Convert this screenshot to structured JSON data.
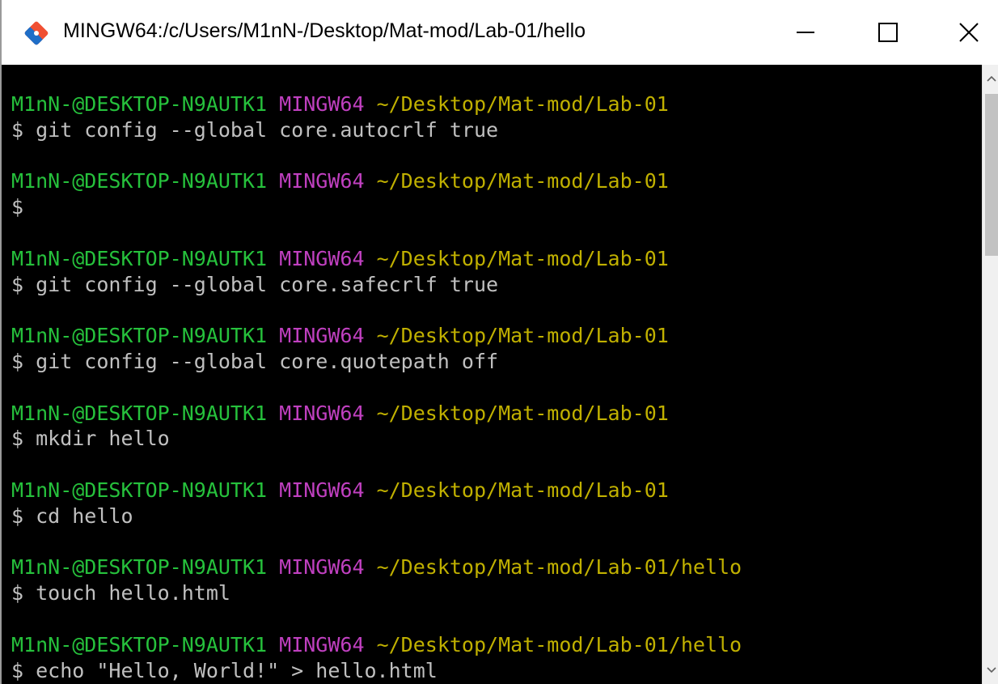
{
  "window": {
    "title": "MINGW64:/c/Users/M1nN-/Desktop/Mat-mod/Lab-01/hello",
    "icon": "git-bash-icon",
    "controls": [
      "minimize-icon",
      "maximize-icon",
      "close-icon"
    ]
  },
  "colors": {
    "user": "#26c13c",
    "msystem": "#c040c0",
    "path": "#c0b000",
    "command": "#c0c0c0",
    "background": "#000000"
  },
  "terminal": {
    "blocks": [
      {
        "user": "M1nN-@DESKTOP-N9AUTK1",
        "msystem": "MINGW64",
        "path": "~/Desktop/Mat-mod/Lab-01",
        "command": "$ git config --global core.autocrlf true"
      },
      {
        "user": "M1nN-@DESKTOP-N9AUTK1",
        "msystem": "MINGW64",
        "path": "~/Desktop/Mat-mod/Lab-01",
        "command": "$"
      },
      {
        "user": "M1nN-@DESKTOP-N9AUTK1",
        "msystem": "MINGW64",
        "path": "~/Desktop/Mat-mod/Lab-01",
        "command": "$ git config --global core.safecrlf true"
      },
      {
        "user": "M1nN-@DESKTOP-N9AUTK1",
        "msystem": "MINGW64",
        "path": "~/Desktop/Mat-mod/Lab-01",
        "command": "$ git config --global core.quotepath off"
      },
      {
        "user": "M1nN-@DESKTOP-N9AUTK1",
        "msystem": "MINGW64",
        "path": "~/Desktop/Mat-mod/Lab-01",
        "command": "$ mkdir hello"
      },
      {
        "user": "M1nN-@DESKTOP-N9AUTK1",
        "msystem": "MINGW64",
        "path": "~/Desktop/Mat-mod/Lab-01",
        "command": "$ cd hello"
      },
      {
        "user": "M1nN-@DESKTOP-N9AUTK1",
        "msystem": "MINGW64",
        "path": "~/Desktop/Mat-mod/Lab-01/hello",
        "command": "$ touch hello.html"
      },
      {
        "user": "M1nN-@DESKTOP-N9AUTK1",
        "msystem": "MINGW64",
        "path": "~/Desktop/Mat-mod/Lab-01/hello",
        "command": "$ echo \"Hello, World!\" > hello.html"
      }
    ]
  }
}
